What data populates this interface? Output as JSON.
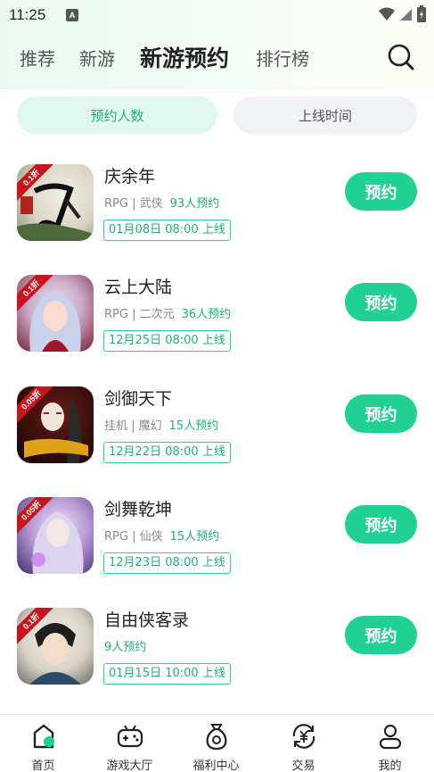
{
  "status_bar": {
    "time": "11:25",
    "notification_icon": "A"
  },
  "top_nav": {
    "tabs": [
      {
        "label": "推荐"
      },
      {
        "label": "新游"
      },
      {
        "label": "新游预约",
        "active": true
      },
      {
        "label": "排行榜"
      }
    ],
    "search_icon": "search-icon"
  },
  "sort": {
    "options": [
      {
        "label": "预约人数",
        "active": true
      },
      {
        "label": "上线时间",
        "active": false
      }
    ]
  },
  "games": [
    {
      "name": "庆余年",
      "meta": "RPG | 武侠",
      "count": "93人预约",
      "launch": "01月08日 08:00 上线",
      "discount": "0.1折",
      "button": "预约"
    },
    {
      "name": "云上大陆",
      "meta": "RPG | 二次元",
      "count": "36人预约",
      "launch": "12月25日 08:00 上线",
      "discount": "0.1折",
      "button": "预约"
    },
    {
      "name": "剑御天下",
      "meta": "挂机 | 魔幻",
      "count": "15人预约",
      "launch": "12月22日 08:00 上线",
      "discount": "0.05折",
      "button": "预约"
    },
    {
      "name": "剑舞乾坤",
      "meta": "RPG | 仙侠",
      "count": "15人预约",
      "launch": "12月23日 08:00 上线",
      "discount": "0.05折",
      "button": "预约"
    },
    {
      "name": "自由侠客录",
      "meta": "",
      "count": "9人预约",
      "launch": "01月15日 10:00 上线",
      "discount": "0.1折",
      "button": "预约"
    }
  ],
  "bottom_nav": {
    "items": [
      {
        "label": "首页",
        "icon": "home-icon",
        "active": true
      },
      {
        "label": "游戏大厅",
        "icon": "gamepad-icon"
      },
      {
        "label": "福利中心",
        "icon": "gift-bag-icon"
      },
      {
        "label": "交易",
        "icon": "yuan-exchange-icon"
      },
      {
        "label": "我的",
        "icon": "user-icon"
      }
    ]
  },
  "colors": {
    "accent": "#21d193",
    "accent_text": "#1fb07c",
    "discount_red": "#c8141c"
  }
}
